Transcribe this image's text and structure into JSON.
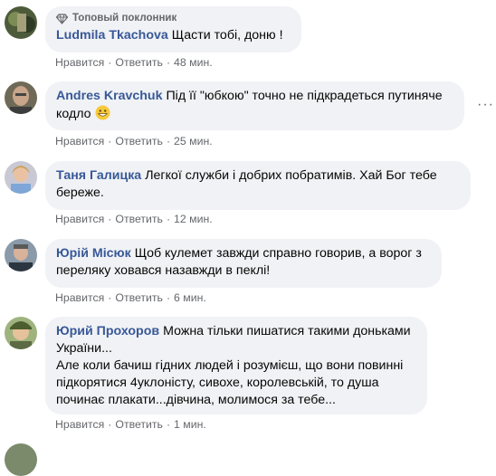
{
  "comments": [
    {
      "badge": "Топовый поклонник",
      "author": "Ludmila Tkachova",
      "text": "Щасти тобі, доню !",
      "like": "Нравится",
      "reply": "Ответить",
      "time": "48 мин."
    },
    {
      "author": "Andres Kravchuk",
      "text": "Під її \"юбкою\" точно не підкрадеться путиняче кодло",
      "like": "Нравится",
      "reply": "Ответить",
      "time": "25 мин.",
      "emoji": "grinning-face"
    },
    {
      "author": "Таня Галицка",
      "text": "Легкої служби і добрих побратимів. Хай Бог тебе береже.",
      "like": "Нравится",
      "reply": "Ответить",
      "time": "12 мин."
    },
    {
      "author": "Юрій Місюк",
      "text": "Щоб кулемет завжди справно говорив, а ворог з переляку ховався назавжди в пеклі!",
      "like": "Нравится",
      "reply": "Ответить",
      "time": "6 мин."
    },
    {
      "author": "Юрий Прохоров",
      "text_line1": "Можна тільки пишатися такими доньками України...",
      "text_line2": "Але коли бачиш гідних людей і розумієш, що вони повинні підкорятися 4уклоністу, сивохе, королевській, то душа починає плакати...дівчина, молимося за тебе...",
      "like": "Нравится",
      "reply": "Ответить",
      "time": "1 мин."
    }
  ],
  "separator": "·",
  "icons": {
    "badge": "gem-icon",
    "more": "more-options-icon"
  }
}
